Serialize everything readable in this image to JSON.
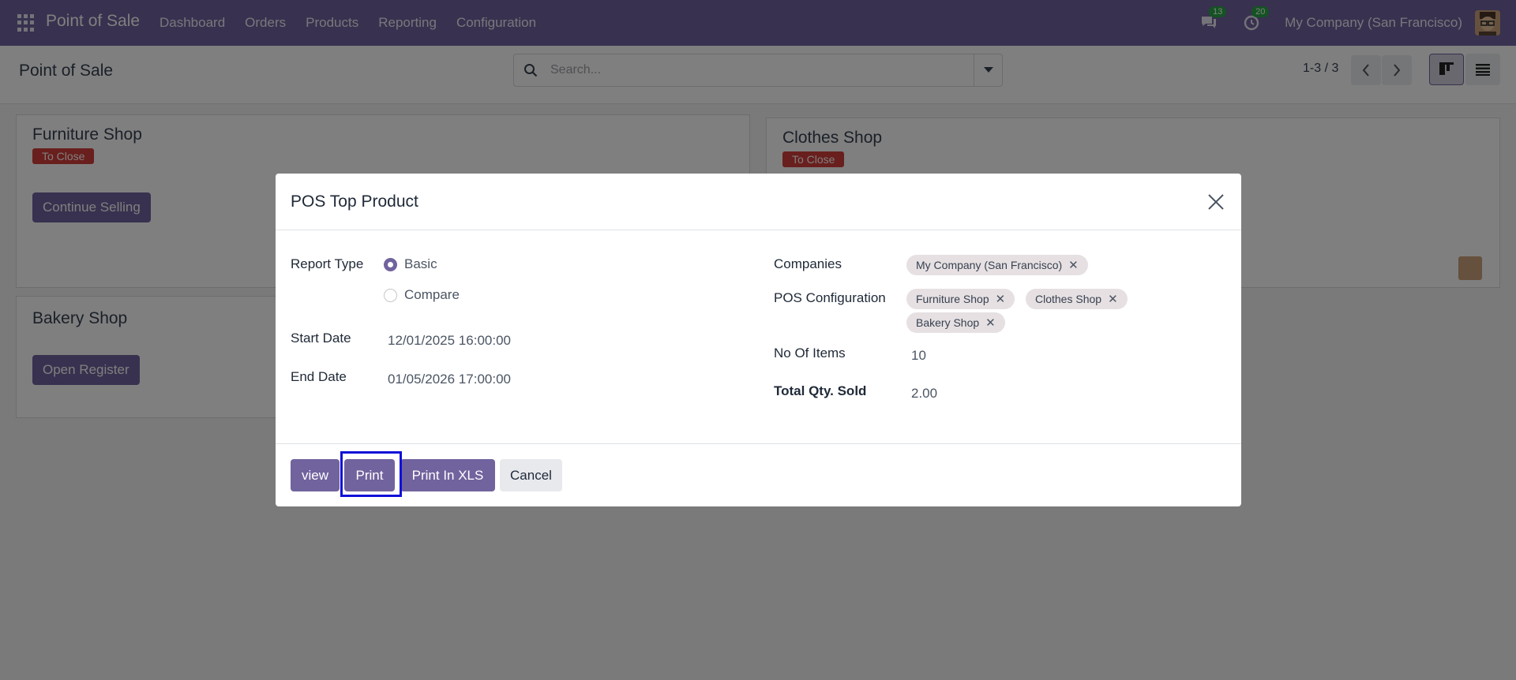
{
  "navbar": {
    "brand": "Point of Sale",
    "menu": [
      "Dashboard",
      "Orders",
      "Products",
      "Reporting",
      "Configuration"
    ],
    "messages_count": "13",
    "activities_count": "20",
    "company": "My Company (San Francisco)"
  },
  "control_panel": {
    "title": "Point of Sale",
    "search_placeholder": "Search...",
    "pager": "1-3 / 3"
  },
  "kanban": {
    "cards": [
      {
        "title": "Furniture Shop",
        "status": "To Close",
        "action": "Continue Selling"
      },
      {
        "title": "Clothes Shop",
        "status": "To Close"
      },
      {
        "title": "Bakery Shop",
        "action": "Open Register"
      }
    ]
  },
  "dialog": {
    "title": "POS Top Product",
    "report_type_label": "Report Type",
    "report_type_options": [
      "Basic",
      "Compare"
    ],
    "report_type_selected": "Basic",
    "start_date_label": "Start Date",
    "start_date": "12/01/2025 16:00:00",
    "end_date_label": "End Date",
    "end_date": "01/05/2026 17:00:00",
    "companies_label": "Companies",
    "companies": [
      "My Company (San Francisco)"
    ],
    "pos_config_label": "POS Configuration",
    "pos_configs": [
      "Furniture Shop",
      "Clothes Shop",
      "Bakery Shop"
    ],
    "no_of_items_label": "No Of Items",
    "no_of_items": "10",
    "total_qty_label": "Total Qty. Sold",
    "total_qty": "2.00",
    "buttons": {
      "view": "view",
      "print": "Print",
      "print_xls": "Print In XLS",
      "cancel": "Cancel"
    }
  },
  "colors": {
    "brand": "#71639e",
    "danger": "#d23f3a",
    "highlight": "#1010d8"
  }
}
